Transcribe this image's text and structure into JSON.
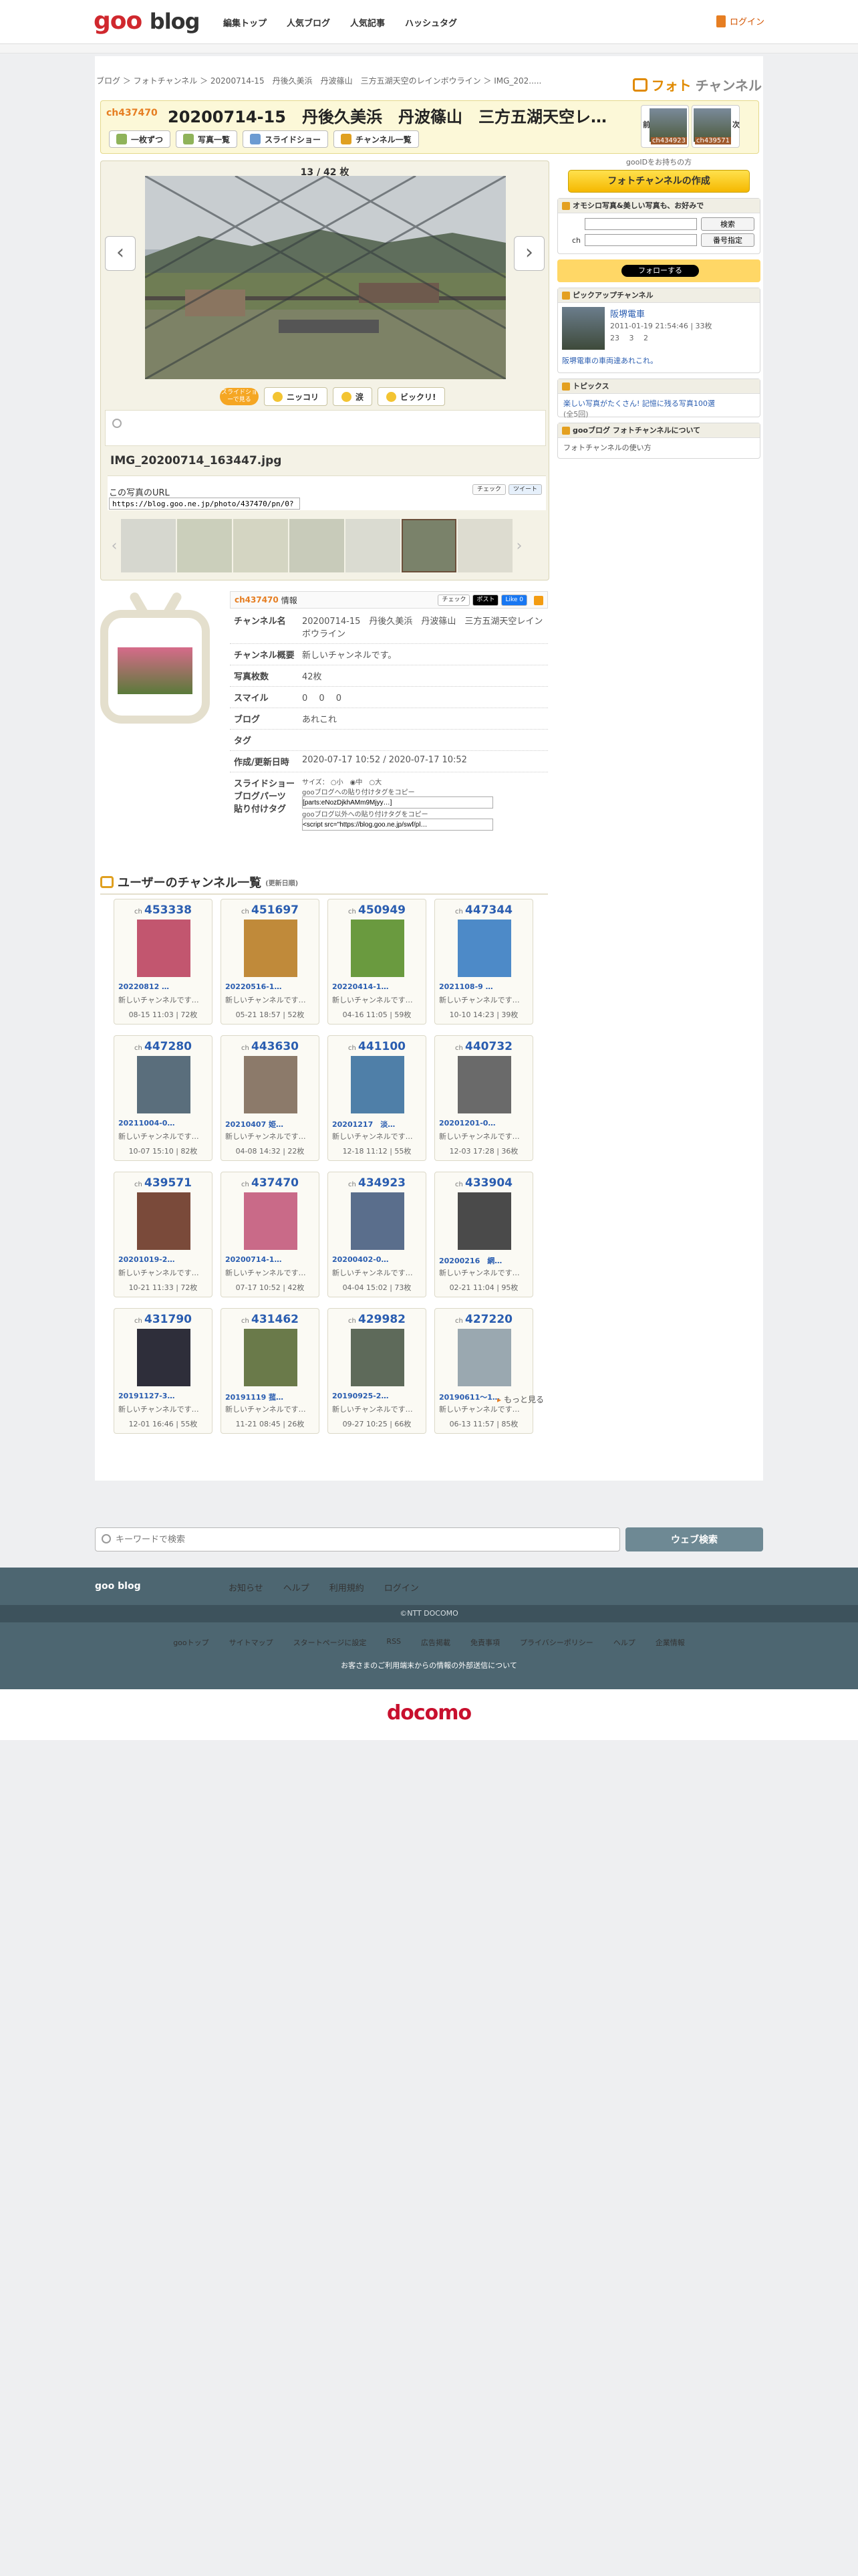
{
  "header": {
    "logo_goo": "goo",
    "logo_blog": "blog",
    "nav": [
      "編集トップ",
      "人気ブログ",
      "人気記事",
      "ハッシュタグ"
    ],
    "login": "ログイン"
  },
  "breadcrumb": "ブログ ＞ フォトチャンネル ＞ 20200714-15　丹後久美浜　丹波篠山　三方五湖天空のレインボウライン ＞ IMG_202.....",
  "fc_logo": {
    "a": "フォト",
    "b": "チャンネル"
  },
  "channel": {
    "id": "ch437470",
    "title": "20200714-15　丹後久美浜　丹波篠山　三方五湖天空レ…",
    "buttons": [
      "一枚ずつ",
      "写真一覧",
      "スライドショー",
      "チャンネル一覧"
    ],
    "prev": {
      "label": "前",
      "id": "ch434923"
    },
    "next": {
      "label": "次",
      "id": "ch439571"
    }
  },
  "viewer": {
    "counter": "13 / 42 枚",
    "badge": "スライドショーで見る",
    "smiles": [
      "ニッコリ",
      "涙",
      "ビックリ!"
    ],
    "filename": "IMG_20200714_163447.jpg",
    "url_label": "この写真のURL",
    "url": "https://blog.goo.ne.jp/photo/437470/pn/0?",
    "share": [
      "チェック",
      "ツイート"
    ]
  },
  "info": {
    "head_id": "ch437470",
    "head_label": "情報",
    "buttons": [
      "チェック",
      "ポスト",
      "Like 0"
    ],
    "rows": [
      {
        "k": "チャンネル名",
        "v": "20200714-15　丹後久美浜　丹波篠山　三方五湖天空レインボウライン"
      },
      {
        "k": "チャンネル概要",
        "v": "新しいチャンネルです。"
      },
      {
        "k": "写真枚数",
        "v": "42枚"
      },
      {
        "k": "スマイル",
        "v": "0　 0　 0"
      },
      {
        "k": "ブログ",
        "v": "あれこれ"
      },
      {
        "k": "タグ",
        "v": ""
      },
      {
        "k": "作成/更新日時",
        "v": "2020-07-17 10:52 / 2020-07-17 10:52"
      }
    ],
    "slide_label": "スライドショー\nブログパーツ\n貼り付けタグ",
    "size_label": "サイズ：",
    "sizes": [
      "小",
      "中",
      "大"
    ],
    "copy1": "gooブログへの貼り付けタグをコピー",
    "tag1": "[parts:eNozDjkhAMm9Mjyy…]",
    "copy2": "gooブログ以外への貼り付けタグをコピー",
    "tag2": "<script src=\"https://blog.goo.ne.jp/swf/pl…"
  },
  "user_channels": {
    "title": "ユーザーのチャンネル一覧",
    "sort": "(更新日順)",
    "more": "もっと見る",
    "cards": [
      {
        "ch": "453338",
        "title": "20220812 …",
        "desc": "新しいチャンネルです…",
        "meta": "08-15 11:03 | 72枚"
      },
      {
        "ch": "451697",
        "title": "20220516-1…",
        "desc": "新しいチャンネルです…",
        "meta": "05-21 18:57 | 52枚"
      },
      {
        "ch": "450949",
        "title": "20220414-1…",
        "desc": "新しいチャンネルです…",
        "meta": "04-16 11:05 | 59枚"
      },
      {
        "ch": "447344",
        "title": "2021108-9 …",
        "desc": "新しいチャンネルです…",
        "meta": "10-10 14:23 | 39枚"
      },
      {
        "ch": "447280",
        "title": "20211004-0…",
        "desc": "新しいチャンネルです…",
        "meta": "10-07 15:10 | 82枚"
      },
      {
        "ch": "443630",
        "title": "20210407 姫…",
        "desc": "新しいチャンネルです…",
        "meta": "04-08 14:32 | 22枚"
      },
      {
        "ch": "441100",
        "title": "20201217　淡…",
        "desc": "新しいチャンネルです…",
        "meta": "12-18 11:12 | 55枚"
      },
      {
        "ch": "440732",
        "title": "20201201-0…",
        "desc": "新しいチャンネルです…",
        "meta": "12-03 17:28 | 36枚"
      },
      {
        "ch": "439571",
        "title": "20201019-2…",
        "desc": "新しいチャンネルです…",
        "meta": "10-21 11:33 | 72枚"
      },
      {
        "ch": "437470",
        "title": "20200714-1…",
        "desc": "新しいチャンネルです…",
        "meta": "07-17 10:52 | 42枚"
      },
      {
        "ch": "434923",
        "title": "20200402-0…",
        "desc": "新しいチャンネルです…",
        "meta": "04-04 15:02 | 73枚"
      },
      {
        "ch": "433904",
        "title": "20200216　網…",
        "desc": "新しいチャンネルです…",
        "meta": "02-21 11:04 | 95枚"
      },
      {
        "ch": "431790",
        "title": "20191127-3…",
        "desc": "新しいチャンネルです…",
        "meta": "12-01 16:46 | 55枚"
      },
      {
        "ch": "431462",
        "title": "20191119 菰…",
        "desc": "新しいチャンネルです…",
        "meta": "11-21 08:45 | 26枚"
      },
      {
        "ch": "429982",
        "title": "20190925-2…",
        "desc": "新しいチャンネルです…",
        "meta": "09-27 10:25 | 66枚"
      },
      {
        "ch": "427220",
        "title": "20190611〜1…",
        "desc": "新しいチャンネルです…",
        "meta": "06-13 11:57 | 85枚"
      }
    ]
  },
  "sidebar": {
    "small": "gooIDをお持ちの方",
    "create": "フォトチャンネルの作成",
    "search_title": "オモシロ写真&美しい写真も、お好みで",
    "search_btn": "検索",
    "ch_label": "ch",
    "number_btn": "番号指定",
    "follow": "フォローする",
    "pickup": {
      "title": "ピックアップチャンネル",
      "name": "阪堺電車",
      "date": "2011-01-19 21:54:46 | 33枚",
      "smiles": "23　 3　 2",
      "desc": "阪堺電車の車両達あれこれ。"
    },
    "topics": {
      "title": "トピックス",
      "item": "楽しい写真がたくさん! 記憶に残る写真100選",
      "item_sub": "(全5回)"
    },
    "about": {
      "title": "gooブログ フォトチャンネルについて",
      "item": "フォトチャンネルの使い方"
    }
  },
  "footer": {
    "search_placeholder": "キーワードで検索",
    "search_btn": "ウェブ検索",
    "brand": "goo blog",
    "links1": [
      "お知らせ",
      "ヘルプ",
      "利用規約",
      "ログイン"
    ],
    "copyright": "©NTT DOCOMO",
    "links2": [
      "gooトップ",
      "サイトマップ",
      "スタートページに設定",
      "RSS",
      "広告掲載",
      "免責事項",
      "プライバシーポリシー",
      "ヘルプ",
      "企業情報"
    ],
    "notice": "お客さまのご利用端末からの情報の外部送信について",
    "docomo": "docomo"
  }
}
